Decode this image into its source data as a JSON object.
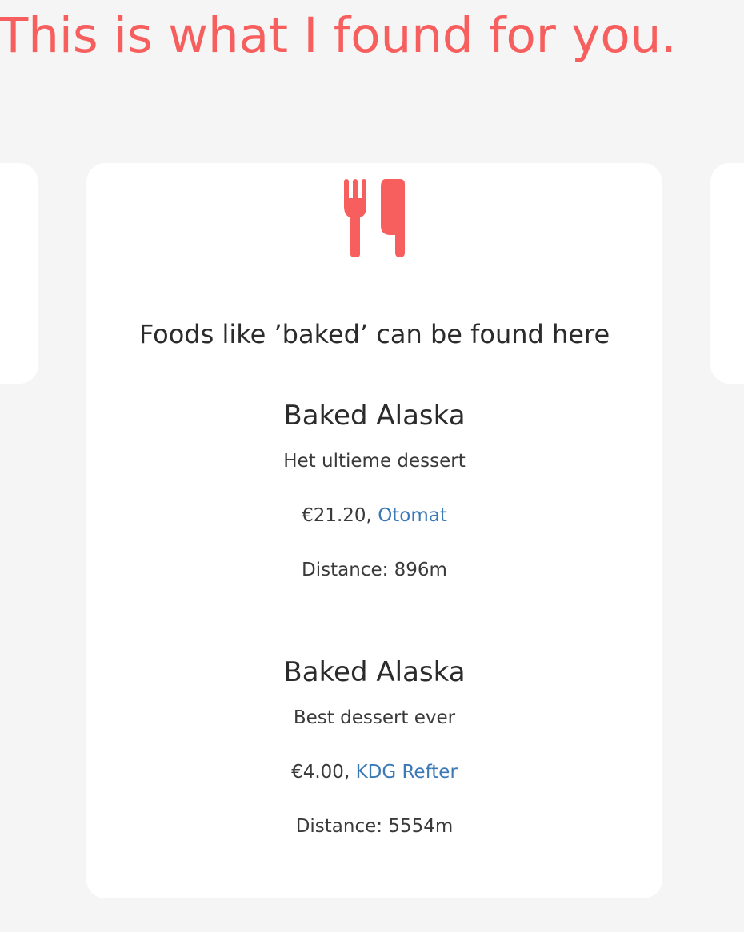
{
  "headline": "This is what I found for you.",
  "card": {
    "icon": "cutlery-icon",
    "heading": "Foods like ’baked’ can be found here",
    "results": [
      {
        "title": "Baked Alaska",
        "description": "Het ultieme dessert",
        "price": "€21.20,",
        "venue": "Otomat",
        "distance": "Distance: 896m"
      },
      {
        "title": "Baked Alaska",
        "description": "Best dessert ever",
        "price": "€4.00,",
        "venue": "KDG Refter",
        "distance": "Distance: 5554m"
      }
    ]
  },
  "colors": {
    "accent": "#f75f5f",
    "link": "#3b78b6",
    "background": "#f5f5f5",
    "card": "#ffffff"
  }
}
